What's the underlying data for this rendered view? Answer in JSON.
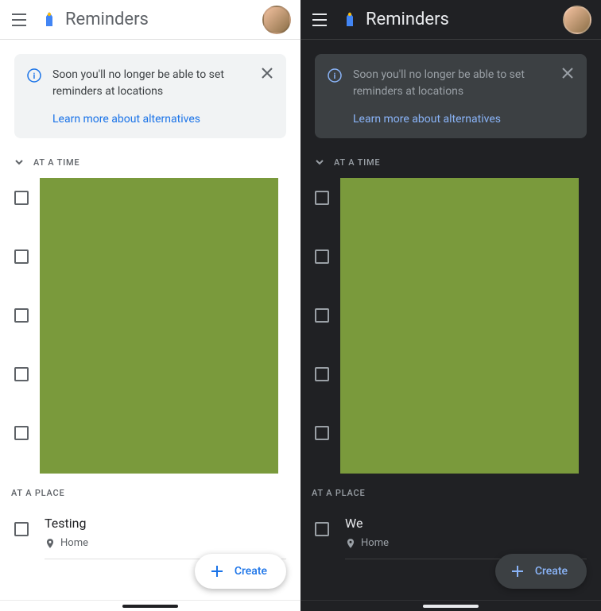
{
  "light": {
    "appTitle": "Reminders",
    "banner": {
      "message": "Soon you'll no longer be able to set reminders at locations",
      "learnMore": "Learn more about alternatives"
    },
    "sections": {
      "time": "AT A TIME",
      "place": "AT A PLACE"
    },
    "placeItem": {
      "title": "Testing",
      "location": "Home"
    },
    "fab": "Create"
  },
  "dark": {
    "appTitle": "Reminders",
    "banner": {
      "message": "Soon you'll no longer be able to set reminders at locations",
      "learnMore": "Learn more about alternatives"
    },
    "sections": {
      "time": "AT A TIME",
      "place": "AT A PLACE"
    },
    "placeItem": {
      "title": "We",
      "location": "Home"
    },
    "fab": "Create"
  }
}
